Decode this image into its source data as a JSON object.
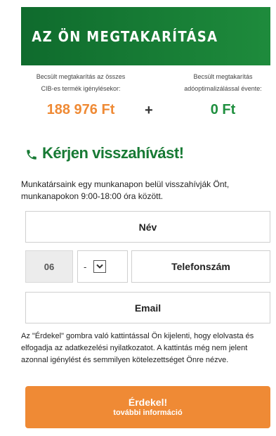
{
  "header": {
    "title": "AZ ÖN MEGTAKARÍTÁSA"
  },
  "savings": {
    "left_label_1": "Becsült megtakarítás az összes",
    "left_label_2": "CIB-es termék igénylésekor:",
    "left_value": "188 976 Ft",
    "plus": "+",
    "right_label_1": "Becsült megtakarítás",
    "right_label_2": "adóoptimalizálással évente:",
    "right_value": "0 Ft"
  },
  "callback": {
    "title": "Kérjen visszahívást!",
    "intro": "Munkatársaink egy munkanapon belül visszahívják Önt, munkanapokon 9:00-18:00 óra között."
  },
  "form": {
    "name_placeholder": "Név",
    "phone_prefix": "06",
    "area_code_value": "-",
    "phone_placeholder": "Telefonszám",
    "email_placeholder": "Email"
  },
  "disclaimer": "Az \"Érdekel\" gombra való kattintással Ön kijelenti, hogy elolvasta és elfogadja az adatkezelési nyilatkozatot. A kattintás még nem jelent azonnal igénylést és semmilyen kötelezettséget Önre nézve.",
  "cta": {
    "main": "Érdekel!",
    "sub": "további információ"
  },
  "colors": {
    "header_green": "#177a34",
    "orange": "#ef8a35",
    "green_value": "#1e8f3e"
  }
}
